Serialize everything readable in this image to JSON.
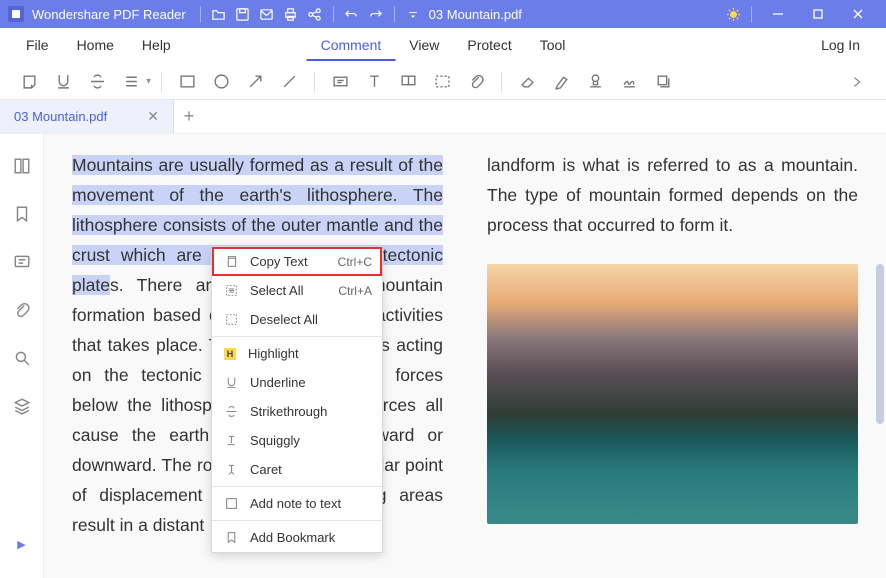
{
  "titlebar": {
    "app_name": "Wondershare PDF Reader",
    "doc_title": "03 Mountain.pdf"
  },
  "menubar": {
    "left": [
      "File",
      "Home",
      "Help"
    ],
    "center": [
      "Comment",
      "View",
      "Protect",
      "Tool"
    ],
    "active": "Comment",
    "login": "Log In"
  },
  "tab": {
    "label": "03 Mountain.pdf"
  },
  "doc": {
    "left_highlighted": "Mountains are usually formed as a result of the movement of the earth's lithosphere. The lithosphere consists of the outer mantle and the crust which are also referred to as tectonic plate",
    "left_plain": "s. There are three types of mountain formation based on the process and activities that takes place. There are many forces acting on the tectonic plates. The igneous forces below the lithosphere and isostatic forces all cause the earth crust to move upward or downward. The rock type at that particular point of displacement and the surrounding areas result in a distant",
    "right_top": "landform is what is referred to as a mountain. The type of mountain formed depends on the process that occurred to form it."
  },
  "context_menu": {
    "items": [
      {
        "label": "Copy Text",
        "shortcut": "Ctrl+C",
        "icon": "copy",
        "highlighted": true
      },
      {
        "label": "Select All",
        "shortcut": "Ctrl+A",
        "icon": "select-all"
      },
      {
        "label": "Deselect All",
        "shortcut": "",
        "icon": "deselect"
      },
      {
        "sep": true
      },
      {
        "label": "Highlight",
        "shortcut": "",
        "icon": "highlight"
      },
      {
        "label": "Underline",
        "shortcut": "",
        "icon": "underline"
      },
      {
        "label": "Strikethrough",
        "shortcut": "",
        "icon": "strike"
      },
      {
        "label": "Squiggly",
        "shortcut": "",
        "icon": "squiggly"
      },
      {
        "label": "Caret",
        "shortcut": "",
        "icon": "caret"
      },
      {
        "sep": true
      },
      {
        "label": "Add note to text",
        "shortcut": "",
        "icon": "note"
      },
      {
        "sep": true
      },
      {
        "label": "Add Bookmark",
        "shortcut": "",
        "icon": "bookmark"
      }
    ]
  }
}
